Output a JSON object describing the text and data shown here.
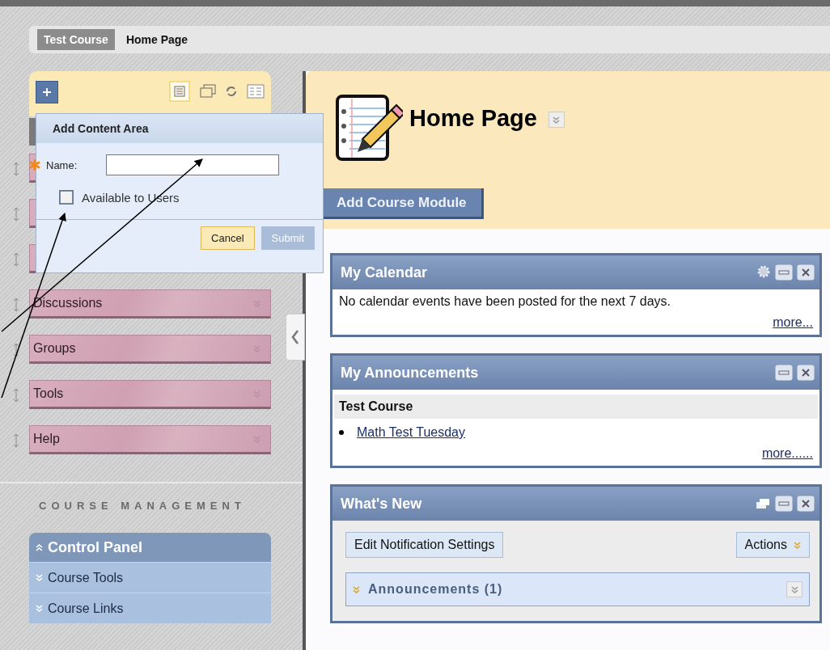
{
  "breadcrumb": {
    "course": "Test Course",
    "page": "Home Page"
  },
  "menu": [
    {
      "label": "Discussions"
    },
    {
      "label": "Groups"
    },
    {
      "label": "Tools"
    },
    {
      "label": "Help"
    }
  ],
  "popup": {
    "title": "Add Content Area",
    "name_label": "Name:",
    "required": true,
    "checkbox": {
      "label": "Available to Users",
      "checked": false
    },
    "cancel": "Cancel",
    "submit": {
      "label": "Submit",
      "disabled": true
    }
  },
  "course_management": {
    "heading": "COURSE MANAGEMENT",
    "panel": {
      "title": "Control Panel",
      "expanded": true,
      "items": [
        {
          "label": "Course Tools",
          "expanded": false
        },
        {
          "label": "Course Links",
          "expanded": false
        }
      ]
    }
  },
  "main": {
    "title": "Home Page",
    "add_button": "Add Course Module",
    "modules": [
      {
        "kind": "calendar",
        "title": "My Calendar",
        "text": "No calendar events have been posted for the next 7 days.",
        "more": "more..."
      },
      {
        "kind": "announcements",
        "title": "My Announcements",
        "course": "Test Course",
        "items": [
          "Math Test Tuesday"
        ],
        "more": "more......"
      },
      {
        "kind": "whats_new",
        "title": "What's New",
        "edit_button": "Edit Notification Settings",
        "actions": "Actions",
        "sections": [
          {
            "label": "Announcements (1)",
            "expanded": false
          }
        ]
      }
    ]
  }
}
